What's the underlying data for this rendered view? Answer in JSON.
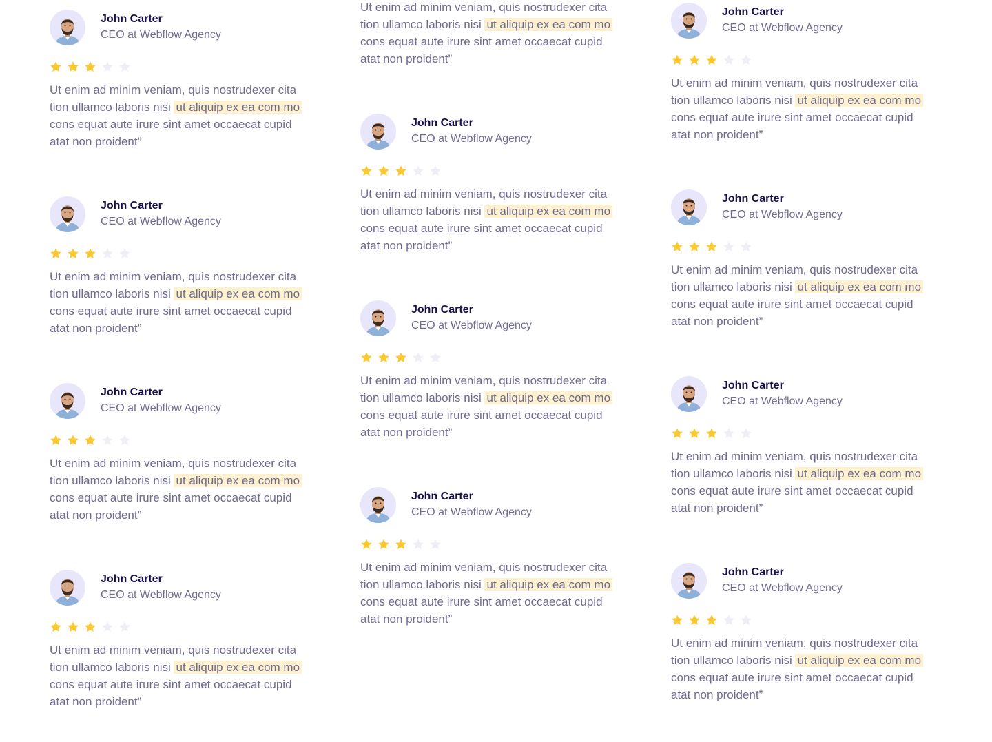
{
  "testimonial": {
    "name": "John Carter",
    "role": "CEO at Webflow Agency",
    "rating": 3,
    "rating_max": 5,
    "line1": "Ut enim ad minim veniam, quis nostrudexer cita",
    "line2_before": "tion ullamco laboris nisi",
    "line2_highlight": "ut aliquip ex ea com mo",
    "line3": "cons equat aute irure sint amet occaecat cupid",
    "line4": "atat non proident”"
  },
  "colors": {
    "star_filled": "#fcc830",
    "star_empty": "#eeeef5",
    "highlight": "#fdf1cf",
    "name": "#170f49",
    "body_text": "#6f6c90",
    "avatar_bg": "#e8e6fb"
  },
  "icons": {
    "avatar": "avatar-icon",
    "star": "star-icon"
  }
}
